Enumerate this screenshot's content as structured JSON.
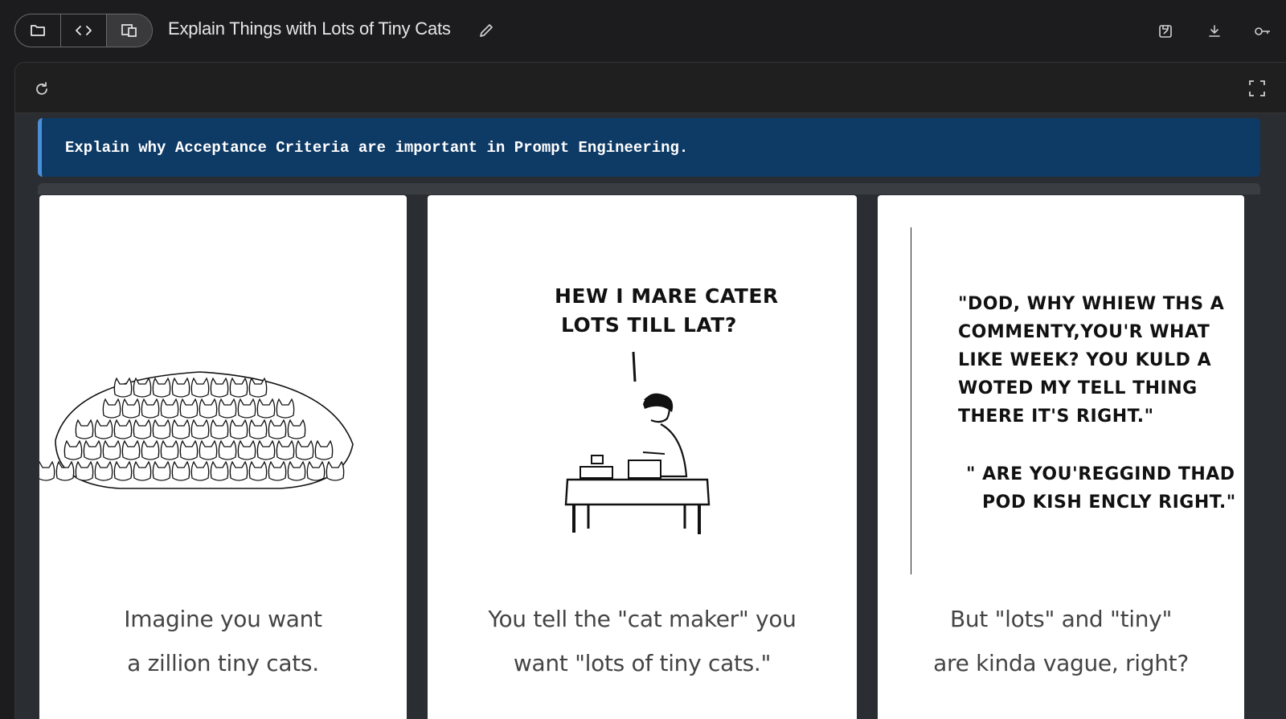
{
  "app": {
    "title": "Explain Things with Lots of Tiny Cats"
  },
  "toolbar": {
    "segments": [
      "folder-icon",
      "code-icon",
      "preview-icon"
    ],
    "right_icons": [
      "save-icon",
      "download-icon",
      "key-icon"
    ]
  },
  "frame": {
    "icons": [
      "reload-icon",
      "fullscreen-icon"
    ]
  },
  "prompt": {
    "text": "Explain why Acceptance Criteria are important in Prompt Engineering."
  },
  "panels": [
    {
      "caption_line1": "Imagine you want",
      "caption_line2": "a zillion tiny cats."
    },
    {
      "bubble_line1": "Hew i mare cater",
      "bubble_line2": "lots till lat?",
      "caption_line1": "You tell the \"cat maker\" you",
      "caption_line2": "want \"lots of tiny cats.\""
    },
    {
      "quote1_line1": "\"Dod, why whiew ths a",
      "quote1_line2": "commenty,you'r what",
      "quote1_line3": "like week? you kuld a",
      "quote1_line4": "woted my tell thing",
      "quote1_line5": "there it's right.\"",
      "quote2_line1": "\" Are you'reggind thad",
      "quote2_line2": "pod kish encly right.\"",
      "caption_line1": "But \"lots\" and \"tiny\"",
      "caption_line2": "are kinda vague, right?"
    }
  ],
  "colors": {
    "background": "#1c1c1e",
    "prompt_bg": "#0e3a66",
    "prompt_accent": "#4a8fd8",
    "panel_bg": "#ffffff"
  }
}
